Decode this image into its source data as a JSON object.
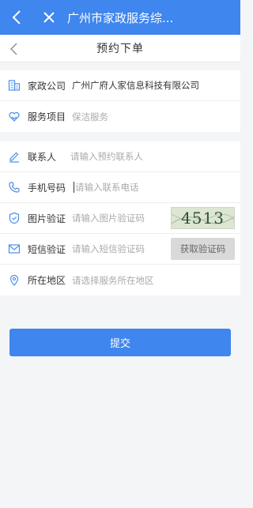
{
  "topbar": {
    "title": "广州市家政服务综...",
    "back_icon": "chevron-left-icon",
    "close_icon": "close-icon"
  },
  "navbar": {
    "title": "预约下单",
    "back_icon": "chevron-left-icon"
  },
  "info": {
    "company": {
      "label": "家政公司",
      "value": "广州广府人家信息科技有限公司",
      "icon": "building-icon"
    },
    "service": {
      "label": "服务项目",
      "value": "保洁服务",
      "icon": "heart-hands-icon"
    }
  },
  "form": {
    "contact": {
      "label": "联系人",
      "placeholder": "请输入预约联系人",
      "icon": "pen-icon"
    },
    "phone": {
      "label": "手机号码",
      "placeholder": "请输入联系电话",
      "icon": "phone-icon"
    },
    "captcha": {
      "label": "图片验证",
      "placeholder": "请输入图片验证码",
      "image_text": "4513",
      "icon": "shield-check-icon"
    },
    "sms": {
      "label": "短信验证",
      "placeholder": "请输入短信验证码",
      "button_label": "获取验证码",
      "icon": "mail-icon"
    },
    "area": {
      "label": "所在地区",
      "placeholder": "请选择服务所在地区",
      "icon": "location-pin-icon"
    }
  },
  "submit_label": "提交",
  "colors": {
    "accent": "#3f86ee",
    "icon": "#4a8de8",
    "disabled_button": "#d9d9d9"
  }
}
